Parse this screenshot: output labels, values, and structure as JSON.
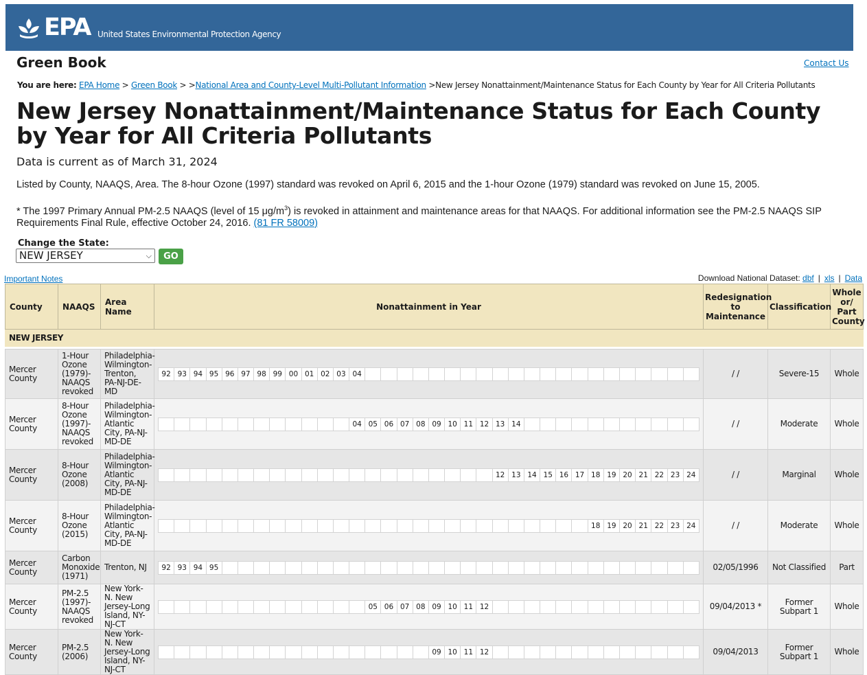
{
  "header": {
    "logo_text": "EPA",
    "agency": "United States Environmental Protection Agency"
  },
  "site_name": "Green Book",
  "contact_link": "Contact Us",
  "breadcrumb": {
    "prefix": "You are here:",
    "items": [
      "EPA Home",
      "Green Book",
      "National Area and County-Level Multi-Pollutant Information"
    ],
    "current": "New Jersey Nonattainment/Maintenance Status for Each County by Year for All Criteria Pollutants"
  },
  "page_title": "New Jersey Nonattainment/Maintenance Status for Each County by Year for All Criteria Pollutants",
  "current_as_of": "Data is current as of March 31, 2024",
  "listed_by": "Listed by County, NAAQS, Area. The 8-hour Ozone (1997) standard was revoked on April 6, 2015 and the 1-hour Ozone (1979) standard was revoked on June 15, 2005.",
  "footnote": {
    "before_sup": "* The 1997 Primary Annual PM-2.5 NAAQS (level of 15 μg/m",
    "sup": "3",
    "after_sup": ") is revoked in attainment and maintenance areas for that NAAQS. For additional information see the PM-2.5 NAAQS SIP Requirements Final Rule, effective October 24, 2016.",
    "link": "(81 FR 58009)"
  },
  "state_selector": {
    "label": "Change the State:",
    "selected": "NEW JERSEY",
    "go_label": "GO"
  },
  "important_notes": "Important Notes",
  "download": {
    "label": "Download National Dataset:",
    "links": [
      "dbf",
      "xls",
      "Data"
    ]
  },
  "table": {
    "columns": [
      "County",
      "NAAQS",
      "Area Name",
      "Nonattainment in Year",
      "Redesignation to Maintenance",
      "Classification",
      "Whole or/ Part County"
    ],
    "state": "NEW JERSEY",
    "year_slots": 34,
    "rows": [
      {
        "county": "Mercer County",
        "naaqs": "1-Hour Ozone (1979)-NAAQS revoked",
        "area": "Philadelphia-Wilmington-Trenton, PA-NJ-DE-MD",
        "years": [
          "92",
          "93",
          "94",
          "95",
          "96",
          "97",
          "98",
          "99",
          "00",
          "01",
          "02",
          "03",
          "04"
        ],
        "start": 0,
        "redesignation": "/ /",
        "classification": "Severe-15",
        "whole_part": "Whole"
      },
      {
        "county": "Mercer County",
        "naaqs": "8-Hour Ozone (1997)-NAAQS revoked",
        "area": "Philadelphia-Wilmington-Atlantic City, PA-NJ-MD-DE",
        "years": [
          "04",
          "05",
          "06",
          "07",
          "08",
          "09",
          "10",
          "11",
          "12",
          "13",
          "14"
        ],
        "start": 12,
        "redesignation": "/ /",
        "classification": "Moderate",
        "whole_part": "Whole"
      },
      {
        "county": "Mercer County",
        "naaqs": "8-Hour Ozone (2008)",
        "area": "Philadelphia-Wilmington-Atlantic City, PA-NJ-MD-DE",
        "years": [
          "12",
          "13",
          "14",
          "15",
          "16",
          "17",
          "18",
          "19",
          "20",
          "21",
          "22",
          "23",
          "24"
        ],
        "start": 21,
        "redesignation": "/ /",
        "classification": "Marginal",
        "whole_part": "Whole"
      },
      {
        "county": "Mercer County",
        "naaqs": "8-Hour Ozone (2015)",
        "area": "Philadelphia-Wilmington-Atlantic City, PA-NJ-MD-DE",
        "years": [
          "18",
          "19",
          "20",
          "21",
          "22",
          "23",
          "24"
        ],
        "start": 27,
        "redesignation": "/ /",
        "classification": "Moderate",
        "whole_part": "Whole"
      },
      {
        "county": "Mercer County",
        "naaqs": "Carbon Monoxide (1971)",
        "area": "Trenton, NJ",
        "years": [
          "92",
          "93",
          "94",
          "95"
        ],
        "start": 0,
        "redesignation": "02/05/1996",
        "classification": "Not Classified",
        "whole_part": "Part"
      },
      {
        "county": "Mercer County",
        "naaqs": "PM-2.5 (1997)-NAAQS revoked",
        "area": "New York-N. New Jersey-Long Island, NY-NJ-CT",
        "years": [
          "05",
          "06",
          "07",
          "08",
          "09",
          "10",
          "11",
          "12"
        ],
        "start": 13,
        "redesignation": "09/04/2013 *",
        "classification": "Former Subpart 1",
        "whole_part": "Whole"
      },
      {
        "county": "Mercer County",
        "naaqs": "PM-2.5 (2006)",
        "area": "New York-N. New Jersey-Long Island, NY-NJ-CT",
        "years": [
          "09",
          "10",
          "11",
          "12"
        ],
        "start": 17,
        "redesignation": "09/04/2013",
        "classification": "Former Subpart 1",
        "whole_part": "Whole"
      }
    ]
  }
}
